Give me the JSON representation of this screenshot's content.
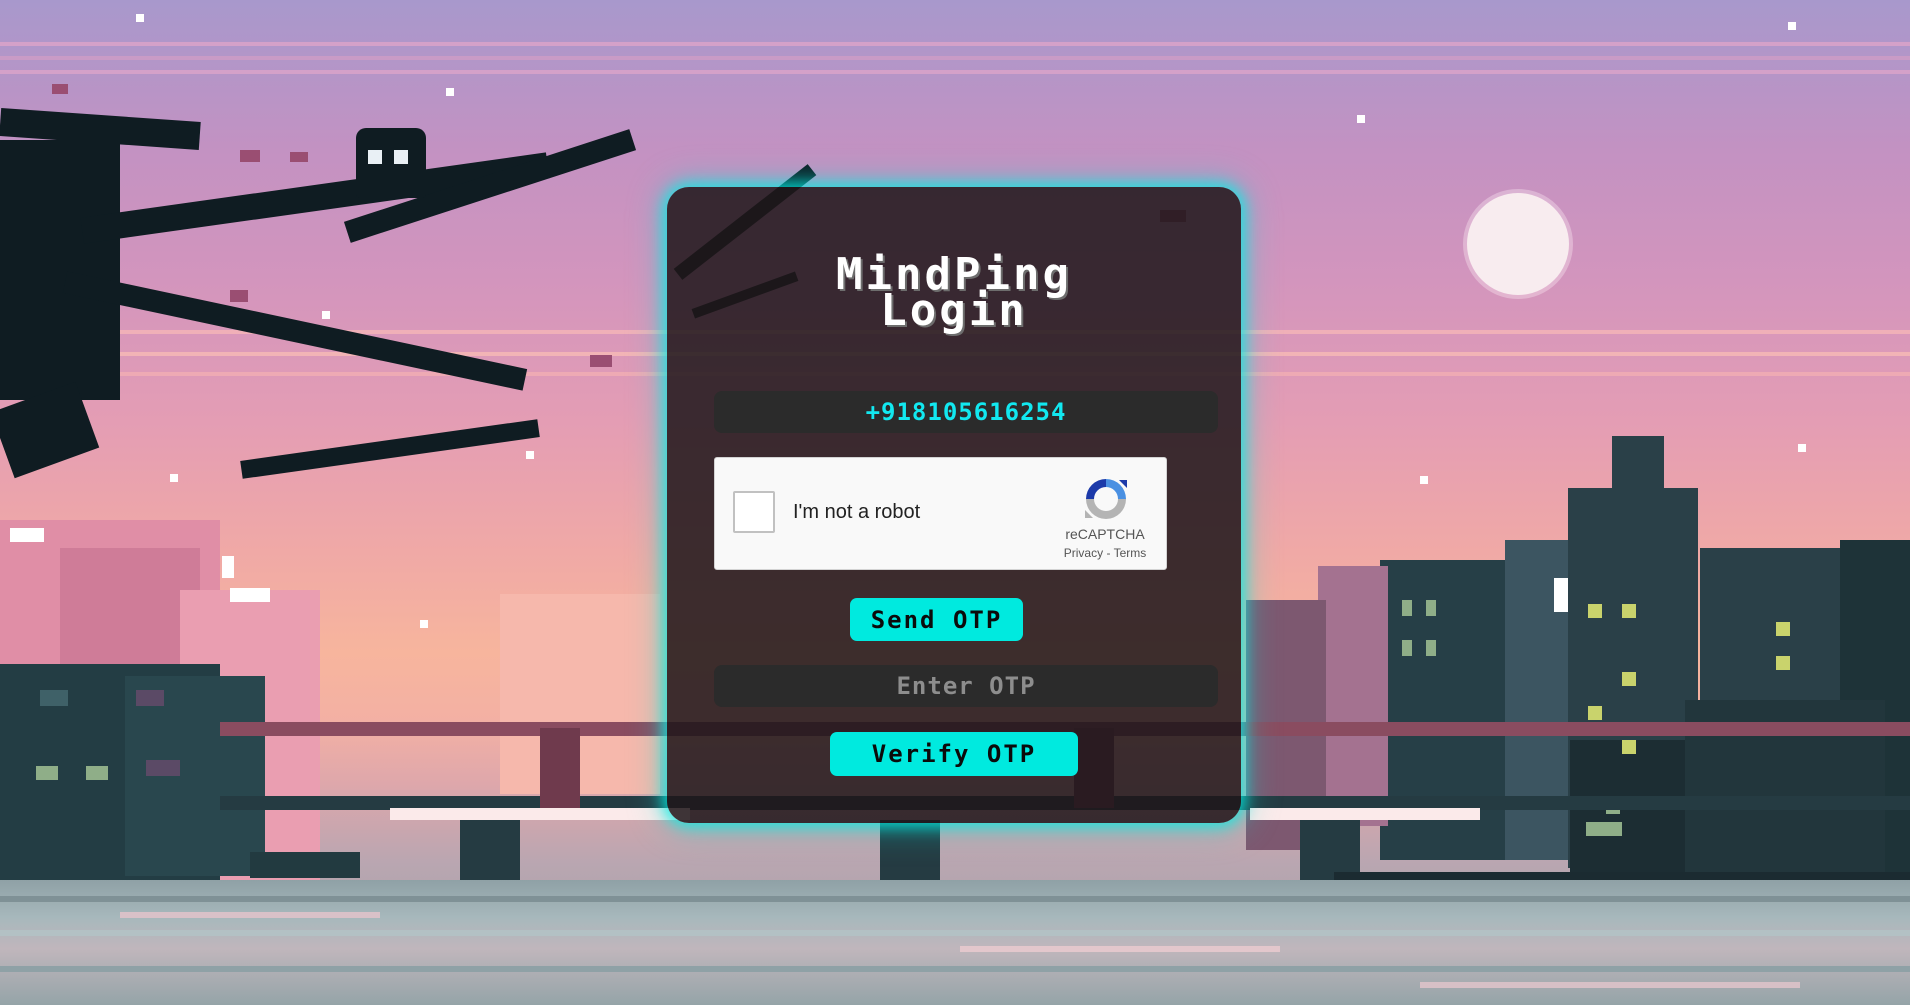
{
  "login": {
    "title": "MindPing\nLogin",
    "phone_value": "+918105616254",
    "otp_placeholder": "Enter OTP",
    "send_otp_label": "Send OTP",
    "verify_otp_label": "Verify OTP"
  },
  "recaptcha": {
    "checkbox_label": "I'm not a robot",
    "brand": "reCAPTCHA",
    "privacy_link": "Privacy",
    "separator": "-",
    "terms_link": "Terms"
  },
  "colors": {
    "accent": "#00eadf",
    "phone_text": "#12e8f0",
    "card_bg": "#1e161a",
    "sky_top": "#a898cc",
    "sky_bottom": "#f7b59d"
  }
}
